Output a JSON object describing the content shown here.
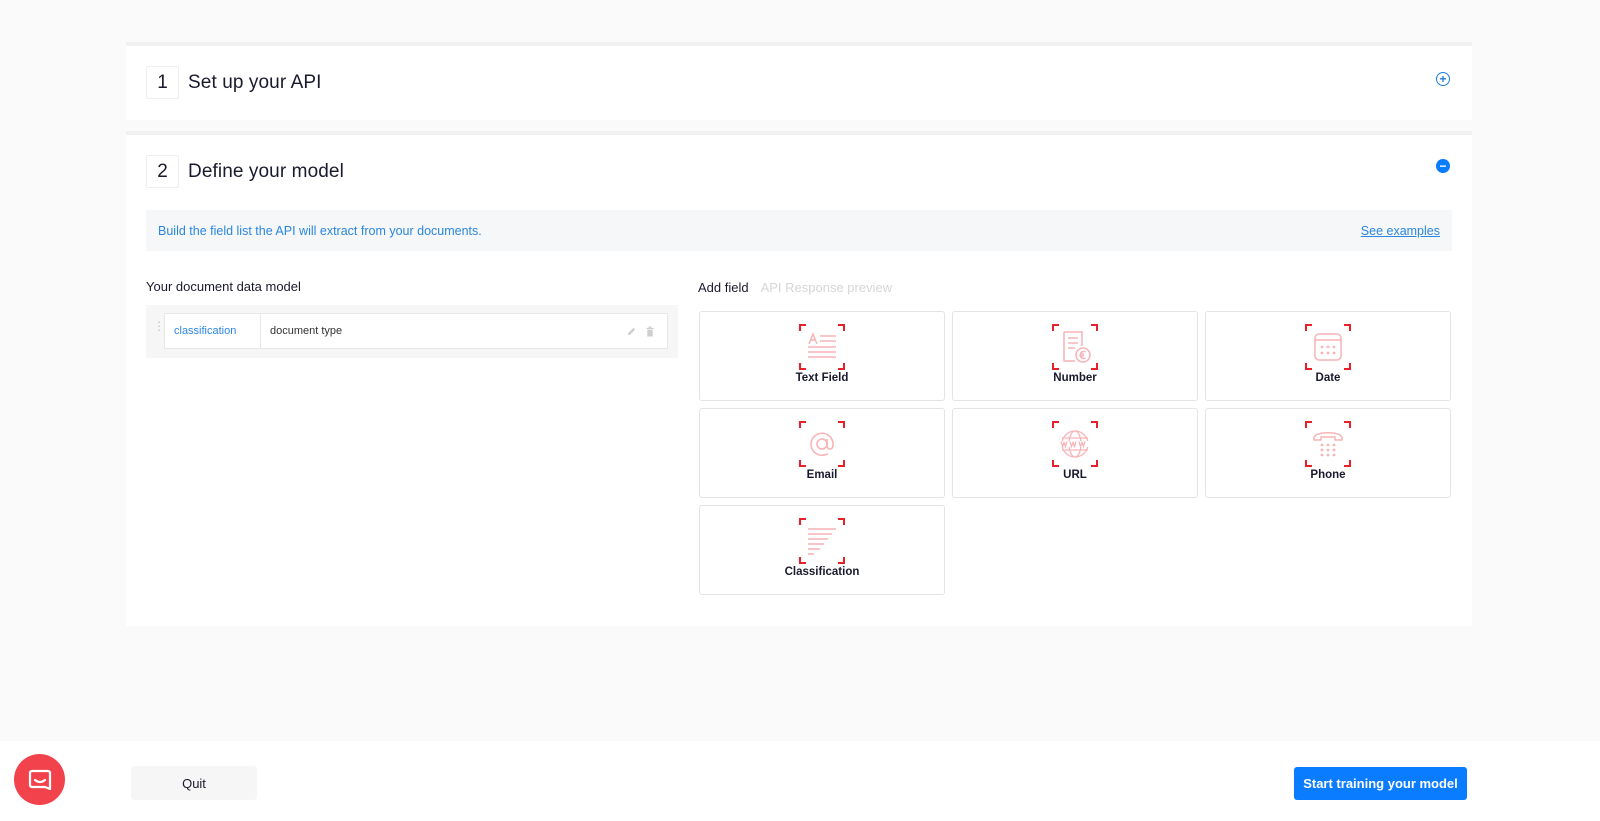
{
  "steps": [
    {
      "number": "1",
      "title": "Set up your API",
      "toggle": "+"
    },
    {
      "number": "2",
      "title": "Define your model",
      "toggle": "−"
    }
  ],
  "banner": {
    "text": "Build the field list the API will extract from your documents.",
    "link": "See examples"
  },
  "model": {
    "label": "Your document data model",
    "fields": [
      {
        "key": "classification",
        "value": "document type"
      }
    ]
  },
  "tabs": [
    {
      "label": "Add field",
      "active": true
    },
    {
      "label": "API Response preview",
      "active": false
    }
  ],
  "field_types": [
    {
      "label": "Text Field",
      "icon": "text-field-icon"
    },
    {
      "label": "Number",
      "icon": "number-icon"
    },
    {
      "label": "Date",
      "icon": "calendar-icon"
    },
    {
      "label": "Email",
      "icon": "at-sign-icon"
    },
    {
      "label": "URL",
      "icon": "globe-www-icon"
    },
    {
      "label": "Phone",
      "icon": "phone-icon"
    },
    {
      "label": "Classification",
      "icon": "classification-icon"
    }
  ],
  "footer": {
    "quit": "Quit",
    "start": "Start training your model"
  },
  "colors": {
    "accent": "#0a7cff",
    "link": "#2b86df",
    "icon_corner": "#e8202a",
    "icon_stroke": "#f6b4b7",
    "chat": "#f2434c"
  }
}
